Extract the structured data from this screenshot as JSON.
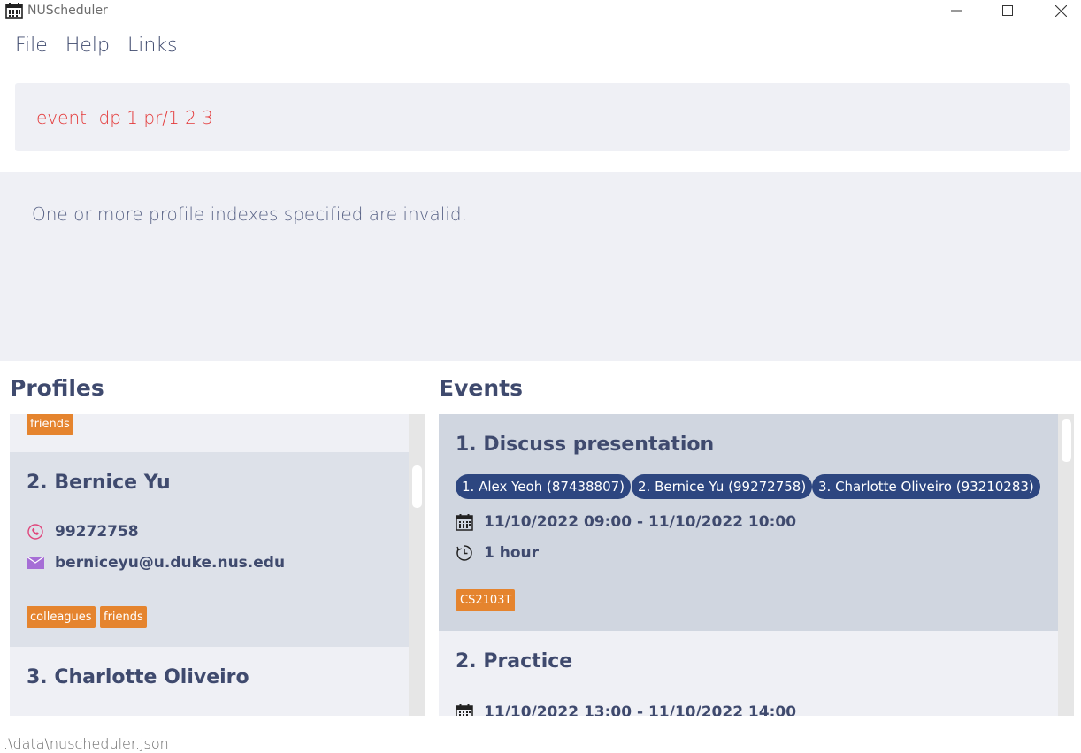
{
  "window": {
    "title": "NUScheduler",
    "icon": "calendar-icon"
  },
  "menu": {
    "file": "File",
    "help": "Help",
    "links": "Links"
  },
  "command": {
    "value": "event -dp 1 pr/1 2 3",
    "color": "#e43b3b"
  },
  "result": {
    "message": "One or more profile indexes specified are invalid."
  },
  "profiles": {
    "header": "Profiles",
    "items": [
      {
        "tags": [
          "friends"
        ]
      },
      {
        "name": "2.  Bernice Yu",
        "phone": "99272758",
        "email": "berniceyu@u.duke.nus.edu",
        "tags": [
          "colleagues",
          "friends"
        ]
      },
      {
        "name": "3.  Charlotte Oliveiro"
      }
    ]
  },
  "events": {
    "header": "Events",
    "items": [
      {
        "title": "1.  Discuss presentation",
        "attendees": [
          "1. Alex Yeoh (87438807)",
          "2. Bernice Yu (99272758)",
          "3. Charlotte Oliveiro (93210283)"
        ],
        "datetime": "11/10/2022 09:00 - 11/10/2022 10:00",
        "duration": "1 hour",
        "tags": [
          "CS2103T"
        ]
      },
      {
        "title": "2.  Practice",
        "datetime": "11/10/2022 13:00 - 11/10/2022 14:00"
      }
    ]
  },
  "status": {
    "path": ".\\data\\nuscheduler.json"
  },
  "colors": {
    "accent": "#3f4a6e",
    "tag": "#e5842e",
    "pill": "#2d4680",
    "phone_icon": "#e0457b",
    "email_icon": "#a66ed6"
  }
}
